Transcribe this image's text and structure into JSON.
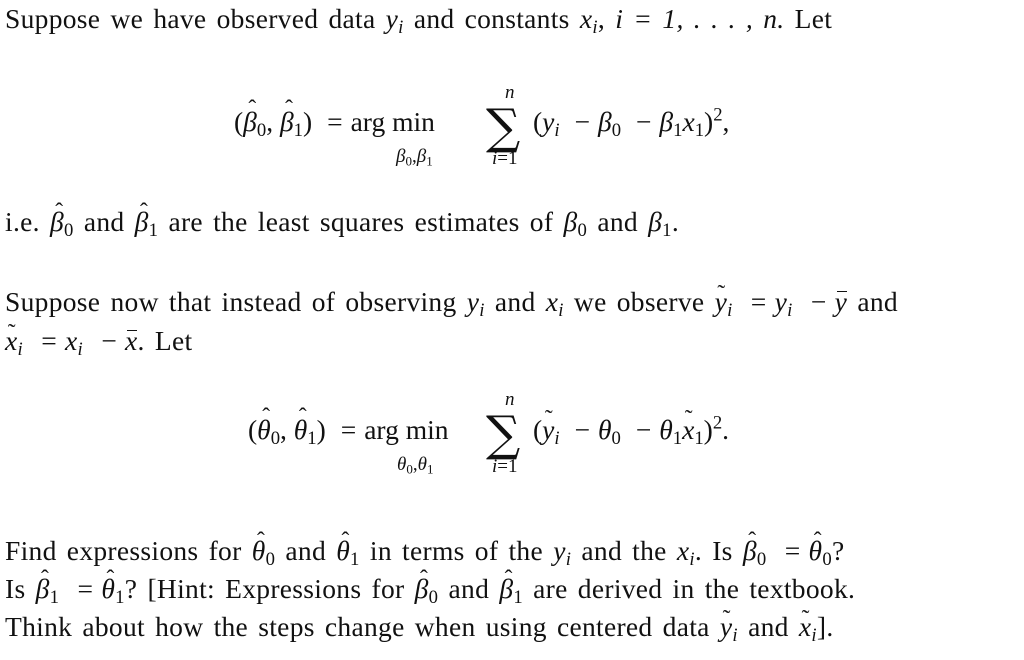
{
  "paragraph_1": {
    "text_a": "Suppose we have observed data",
    "y": "y",
    "i": "i",
    "text_b": "and constants",
    "x": "x",
    "text_c": ",",
    "range": "i = 1, . . . , n.",
    "text_d": "Let"
  },
  "equation_1": {
    "lhs": "(β̂₀, β̂₁)",
    "lhs_open": "(",
    "beta": "β",
    "sub0": "0",
    "sub1": "1",
    "comma": ",",
    "lhs_close": ")",
    "equals": "=",
    "argmin": "arg min",
    "under": "β₀,β₁",
    "sum_upper": "n",
    "sum_lower": "i=1",
    "body_open": "(",
    "y": "y",
    "i": "i",
    "minus": "−",
    "x": "x",
    "body_close": ")",
    "power": "2",
    "trail": ","
  },
  "paragraph_2": {
    "text_a": "i.e.",
    "text_and": "and",
    "text_b": "are the least squares estimates of",
    "text_end": "."
  },
  "paragraph_3": {
    "line1_a": "Suppose now that instead of observing",
    "line1_and": "and",
    "line1_b": "we observe",
    "eq": "=",
    "minus": "−",
    "line1_and2": "and",
    "line2_end": ". Let"
  },
  "equation_2": {
    "theta": "θ",
    "equals": "=",
    "argmin": "arg min",
    "sum_upper": "n",
    "sum_lower": "i=1",
    "minus": "−",
    "power": "2",
    "trail": "."
  },
  "paragraph_4": {
    "line1_a": "Find expressions for",
    "and": "and",
    "line1_b": "in terms of the",
    "line1_c": "and the",
    "line1_d": ". Is",
    "eq": "=",
    "q": "?",
    "line2_a": "Is",
    "line2_b": "? [Hint: Expressions for",
    "line2_c": "are derived in the textbook.",
    "line3_a": "Think about how the steps change when using centered data",
    "line3_end": "]."
  },
  "colors": {
    "text": "#111111",
    "background": "#ffffff"
  }
}
